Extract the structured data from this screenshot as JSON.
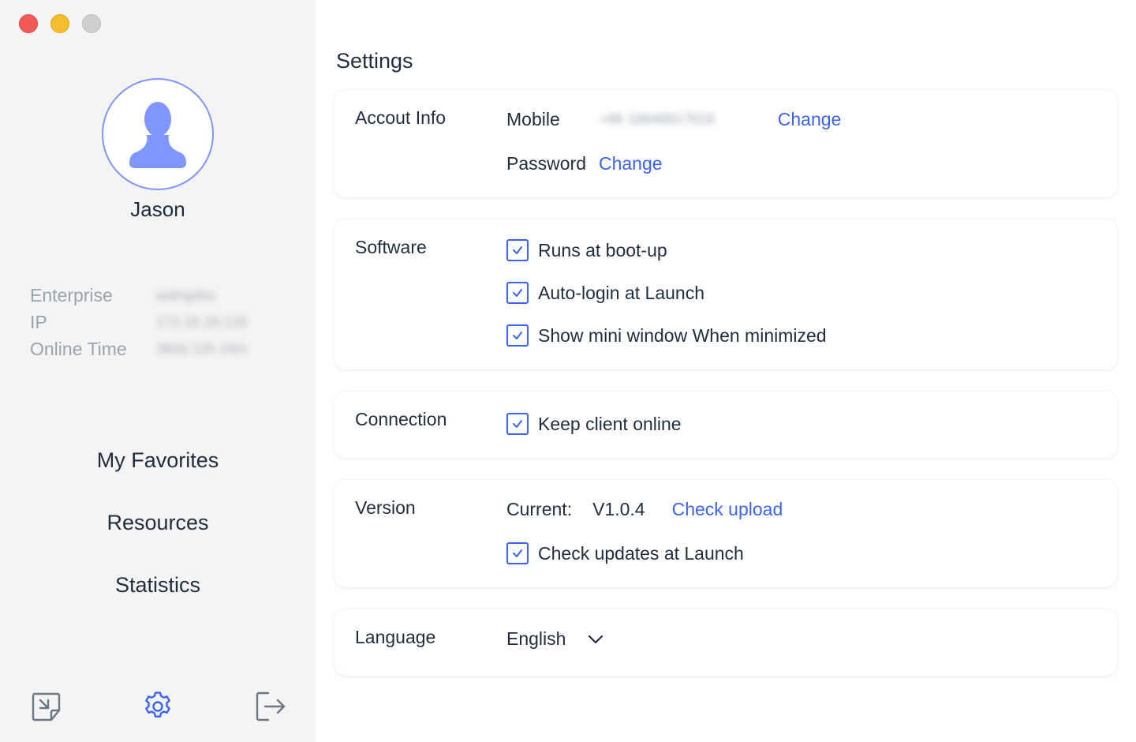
{
  "sidebar": {
    "user": {
      "name": "Jason"
    },
    "info": {
      "labels": [
        "Enterprise",
        "IP",
        "Online Time"
      ],
      "values": [
        "walngdxx",
        "172.16.16.126",
        "360d 12h 24m"
      ]
    },
    "nav": [
      {
        "label": "My Favorites"
      },
      {
        "label": "Resources"
      },
      {
        "label": "Statistics"
      }
    ],
    "bottom_icons": [
      "minimize-window-icon",
      "gear-icon",
      "logout-icon"
    ],
    "colors": {
      "background": "#f4f4f4",
      "active_icon": "#3a63f0",
      "avatar": "#7f95ff"
    }
  },
  "main": {
    "title": "Settings",
    "account": {
      "label": "Accout Info",
      "mobile_label": "Mobile",
      "mobile_value": "+86 18648917618",
      "mobile_change": "Change",
      "password_label": "Password",
      "password_change": "Change"
    },
    "software": {
      "label": "Software",
      "options": [
        {
          "label": "Runs at boot-up",
          "checked": true
        },
        {
          "label": "Auto-login at Launch",
          "checked": true
        },
        {
          "label": "Show mini window When minimized",
          "checked": true
        }
      ]
    },
    "connection": {
      "label": "Connection",
      "options": [
        {
          "label": "Keep client online",
          "checked": true
        }
      ]
    },
    "version": {
      "label": "Version",
      "current_label": "Current:",
      "current_value": "V1.0.4",
      "check_link": "Check upload",
      "auto_check": {
        "label": "Check updates at Launch",
        "checked": true
      }
    },
    "language": {
      "label": "Language",
      "selected": "English"
    }
  },
  "colors": {
    "accent": "#3a63f0",
    "text": "#1f2d3d",
    "muted": "#9ba3ad"
  }
}
